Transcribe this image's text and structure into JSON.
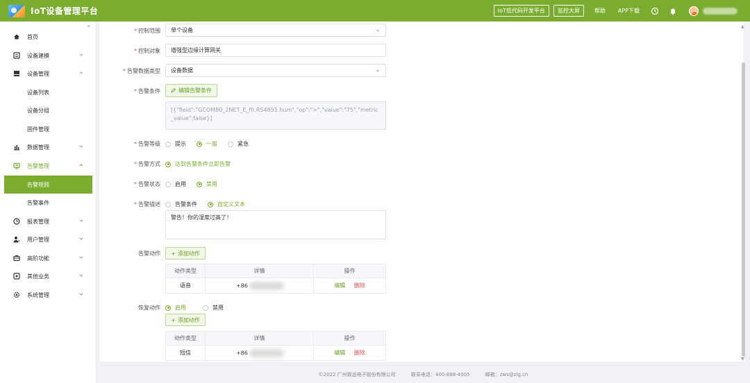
{
  "header": {
    "title": "IoT设备管理平台",
    "lowcode_btn": "IoT低代码开发平台",
    "monitor_btn": "监控大屏",
    "help": "帮助",
    "app_download": "APP下载"
  },
  "sidebar": {
    "collapse": "«",
    "items": [
      {
        "label": "首页",
        "icon": "home-icon"
      },
      {
        "label": "设备建模",
        "icon": "model-icon"
      },
      {
        "label": "设备管理",
        "icon": "device-icon"
      },
      {
        "label": "设备列表"
      },
      {
        "label": "设备分组"
      },
      {
        "label": "固件管理"
      },
      {
        "label": "数据管理",
        "icon": "chart-icon"
      },
      {
        "label": "告警管理",
        "icon": "alarm-icon"
      },
      {
        "label": "告警规则"
      },
      {
        "label": "告警事件"
      },
      {
        "label": "报表管理",
        "icon": "report-icon"
      },
      {
        "label": "用户管理",
        "icon": "user-icon"
      },
      {
        "label": "高阶功能",
        "icon": "advanced-icon"
      },
      {
        "label": "其他业务",
        "icon": "other-icon"
      },
      {
        "label": "系统管理",
        "icon": "settings-icon"
      }
    ]
  },
  "form": {
    "scope": {
      "label": "控制范围",
      "value": "单个设备"
    },
    "target": {
      "label": "控制对象",
      "value": "增强型边缘计算网关"
    },
    "data_type": {
      "label": "告警数据类型",
      "value": "设备数据"
    },
    "condition": {
      "label": "告警条件",
      "btn": "编辑告警条件",
      "value": "[{\"field\":\"GCOM80_2NET_E_fh.RS4851.hum\",\"op\":\">\",\"value\":\"75\",\"metric_value\":false}]"
    },
    "level": {
      "label": "告警等级",
      "options": [
        "提示",
        "一般",
        "紧急"
      ],
      "selected": "一般"
    },
    "method": {
      "label": "告警方式",
      "options": [
        "达到告警条件立即告警"
      ],
      "selected": "达到告警条件立即告警"
    },
    "status": {
      "label": "告警状态",
      "options": [
        "启用",
        "禁用"
      ],
      "selected": "禁用"
    },
    "desc": {
      "label": "告警描述",
      "options": [
        "告警条件",
        "自定义文本"
      ],
      "selected": "自定义文本",
      "text": "警告！你的湿度过高了！"
    },
    "action": {
      "label": "告警动作",
      "add_btn": "添加动作",
      "columns": [
        "动作类型",
        "详情",
        "操作"
      ],
      "row": {
        "type": "语音",
        "detail": "+86",
        "edit": "编辑",
        "delete": "删除"
      }
    },
    "recover": {
      "label": "恢复动作",
      "options": [
        "启用",
        "禁用"
      ],
      "selected": "启用",
      "add_btn": "添加动作",
      "columns": [
        "动作类型",
        "详情",
        "操作"
      ],
      "row": {
        "type": "短信",
        "detail": "+86",
        "edit": "编辑",
        "delete": "删除"
      }
    }
  },
  "footer": {
    "copyright": "©2022 广州致远电子股份有限公司",
    "phone": "联系电话：400-888-4005",
    "email": "邮箱：zws@zlg.cn"
  },
  "colors": {
    "brand": "#7aad2f",
    "danger": "#e05050"
  }
}
